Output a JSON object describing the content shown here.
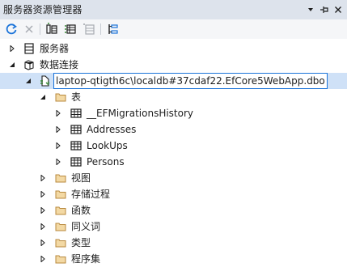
{
  "window": {
    "title": "服务器资源管理器"
  },
  "title_buttons": [
    {
      "name": "dropdown-icon",
      "glyph": "▾"
    },
    {
      "name": "pin-icon",
      "glyph": "⊣"
    },
    {
      "name": "close-icon",
      "glyph": "✕"
    }
  ],
  "toolbar": {
    "items": [
      "refresh-icon",
      "stop-icon",
      "connect-database-icon",
      "connect-server-icon",
      "connect-azure-icon",
      "filter-icon"
    ]
  },
  "tree": {
    "servers": {
      "label": "服务器"
    },
    "data_connections": {
      "label": "数据连接"
    },
    "connection": {
      "label": "laptop-qtigth6c\\localdb#37cdaf22.EfCore5WebApp.dbo"
    },
    "tables": {
      "label": "表",
      "items": [
        {
          "label": "__EFMigrationsHistory"
        },
        {
          "label": "Addresses"
        },
        {
          "label": "LookUps"
        },
        {
          "label": "Persons"
        }
      ]
    },
    "folders": [
      {
        "label": "视图"
      },
      {
        "label": "存储过程"
      },
      {
        "label": "函数"
      },
      {
        "label": "同义词"
      },
      {
        "label": "类型"
      },
      {
        "label": "程序集"
      }
    ]
  },
  "colors": {
    "titlebar": "#dde3ec",
    "selection": "#cfe1f7",
    "selection_border": "#1a73d9",
    "folder": "#dcb67a"
  }
}
